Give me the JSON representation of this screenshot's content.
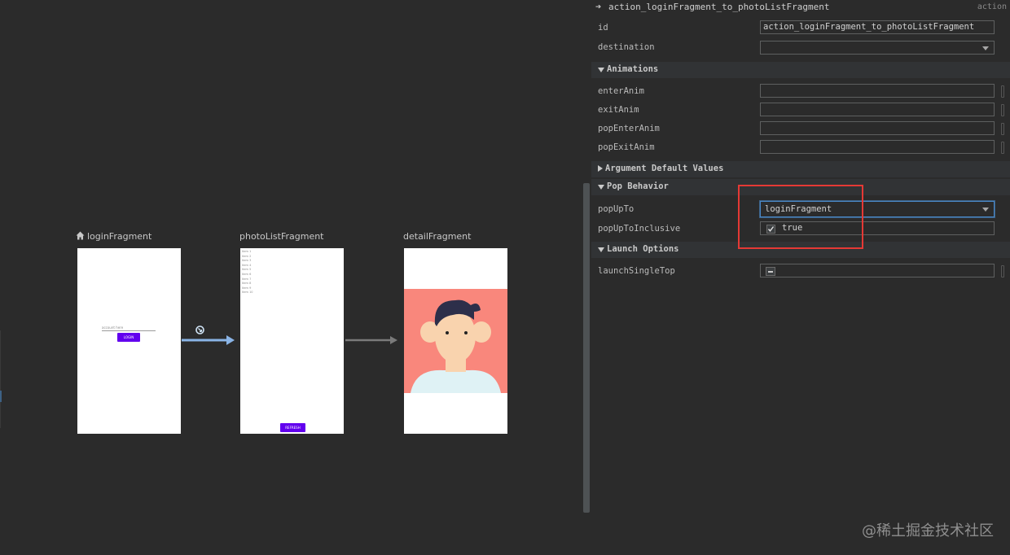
{
  "graph": {
    "login": {
      "label": "loginFragment",
      "field_hint": "account here",
      "button": "LOGIN"
    },
    "photo_list": {
      "label": "photoListFragment",
      "items": [
        "Item 1",
        "Item 2",
        "Item 3",
        "Item 4",
        "Item 5",
        "Item 6",
        "Item 7",
        "Item 8",
        "Item 9",
        "Item 10"
      ],
      "button": "REFRESH"
    },
    "detail": {
      "label": "detailFragment"
    }
  },
  "panel": {
    "header": {
      "title": "action_loginFragment_to_photoListFragment",
      "type": "action"
    },
    "id": {
      "label": "id",
      "value": "action_loginFragment_to_photoListFragment"
    },
    "destination": {
      "label": "destination",
      "value": ""
    },
    "animations": {
      "title": "Animations",
      "enter": "enterAnim",
      "exit": "exitAnim",
      "pop_enter": "popEnterAnim",
      "pop_exit": "popExitAnim"
    },
    "argument_defaults": {
      "title": "Argument Default Values"
    },
    "pop_behavior": {
      "title": "Pop Behavior",
      "pop_up_to_label": "popUpTo",
      "pop_up_to_value": "loginFragment",
      "inclusive_label": "popUpToInclusive",
      "inclusive_value": "true"
    },
    "launch_options": {
      "title": "Launch Options",
      "single_top_label": "launchSingleTop"
    }
  },
  "watermark": "@稀土掘金技术社区",
  "colors": {
    "accent": "#6200ee",
    "highlight": "#e53935",
    "focus": "#4a88c7",
    "action_arrow": "#8ab4e6"
  }
}
